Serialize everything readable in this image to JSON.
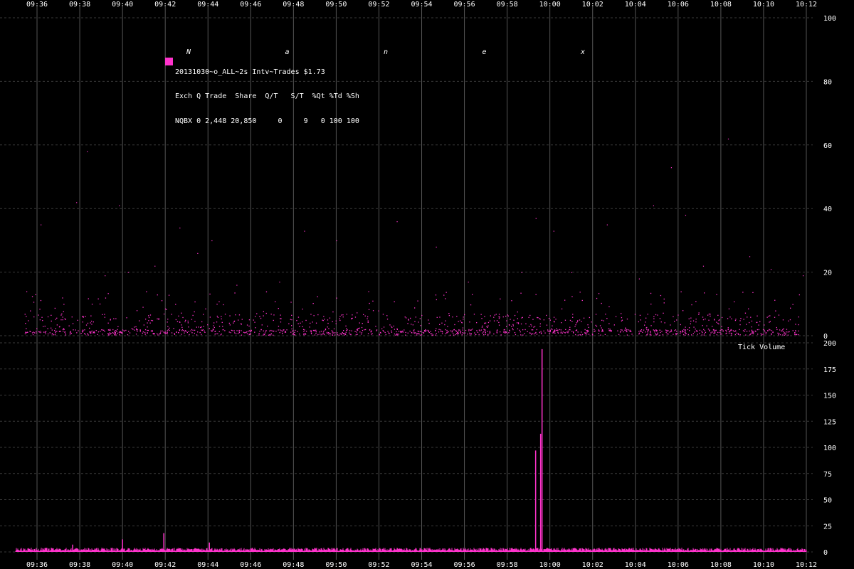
{
  "watermark": "Nanex",
  "legend": {
    "title": "20131030~o_ALL~2s Intv~Trades $1.73",
    "header": "Exch Q Trade  Share  Q/T   S/T  %Qt %Td %Sh",
    "row": "NQBX 0 2,448 20,850     0     9   0 100 100"
  },
  "colors": {
    "background": "#000000",
    "series": "#ff33cc",
    "grid_vertical": "#555555",
    "grid_horizontal": "#3a3a3a",
    "text": "#ffffff",
    "watermark": "#1c1c1c"
  },
  "chart_data": [
    {
      "type": "scatter",
      "x_tick_labels": [
        "09:36",
        "09:38",
        "09:40",
        "09:42",
        "09:44",
        "09:46",
        "09:48",
        "09:50",
        "09:52",
        "09:54",
        "09:56",
        "09:58",
        "10:00",
        "10:02",
        "10:04",
        "10:06",
        "10:08",
        "10:10",
        "10:12"
      ],
      "xlim": [
        "09:35",
        "10:12"
      ],
      "ylim": [
        0,
        100
      ],
      "y_ticks": [
        0,
        20,
        40,
        60,
        80,
        100
      ],
      "grid": true,
      "series": [
        {
          "name": "NQBX",
          "points_note": "dense cluster of trade-size dots mostly between 0 and 15, occasional outliers",
          "x": [
            "09:35:30",
            "09:36:10",
            "09:37:50",
            "09:38:20",
            "09:39:10",
            "09:39:50",
            "09:40:15",
            "09:41:30",
            "09:42:40",
            "09:43:30",
            "09:44:10",
            "09:45:20",
            "09:47:20",
            "09:48:30",
            "09:50:00",
            "09:51:30",
            "09:52:50",
            "09:54:40",
            "09:56:10",
            "09:58:40",
            "09:59:20",
            "10:00:10",
            "10:01:00",
            "10:02:40",
            "10:04:10",
            "10:04:50",
            "10:05:40",
            "10:06:20",
            "10:07:10",
            "10:08:20",
            "10:09:20",
            "10:10:20",
            "10:11:50"
          ],
          "y": [
            14,
            35,
            42,
            58,
            19,
            41,
            20,
            22,
            34,
            26,
            30,
            16,
            17,
            33,
            30,
            14,
            36,
            28,
            17,
            20,
            37,
            33,
            20,
            35,
            18,
            41,
            53,
            38,
            22,
            62,
            25,
            21,
            19
          ]
        }
      ]
    },
    {
      "type": "bar",
      "title": "Tick Volume",
      "x_tick_labels": [
        "09:36",
        "09:38",
        "09:40",
        "09:42",
        "09:44",
        "09:46",
        "09:48",
        "09:50",
        "09:52",
        "09:54",
        "09:56",
        "09:58",
        "10:00",
        "10:02",
        "10:04",
        "10:06",
        "10:08",
        "10:10",
        "10:12"
      ],
      "xlim": [
        "09:35",
        "10:12"
      ],
      "ylim": [
        0,
        200
      ],
      "y_ticks": [
        0,
        25,
        50,
        75,
        100,
        125,
        150,
        175,
        200
      ],
      "grid": true,
      "series": [
        {
          "name": "NQBX",
          "notable_bars": [
            {
              "x": "09:37:40",
              "value": 7
            },
            {
              "x": "09:40:00",
              "value": 12
            },
            {
              "x": "09:41:56",
              "value": 18
            },
            {
              "x": "09:44:04",
              "value": 9
            },
            {
              "x": "09:59:20",
              "value": 97
            },
            {
              "x": "09:59:34",
              "value": 113
            },
            {
              "x": "09:59:38",
              "value": 194
            }
          ],
          "baseline_range": [
            1,
            4
          ]
        }
      ]
    }
  ]
}
